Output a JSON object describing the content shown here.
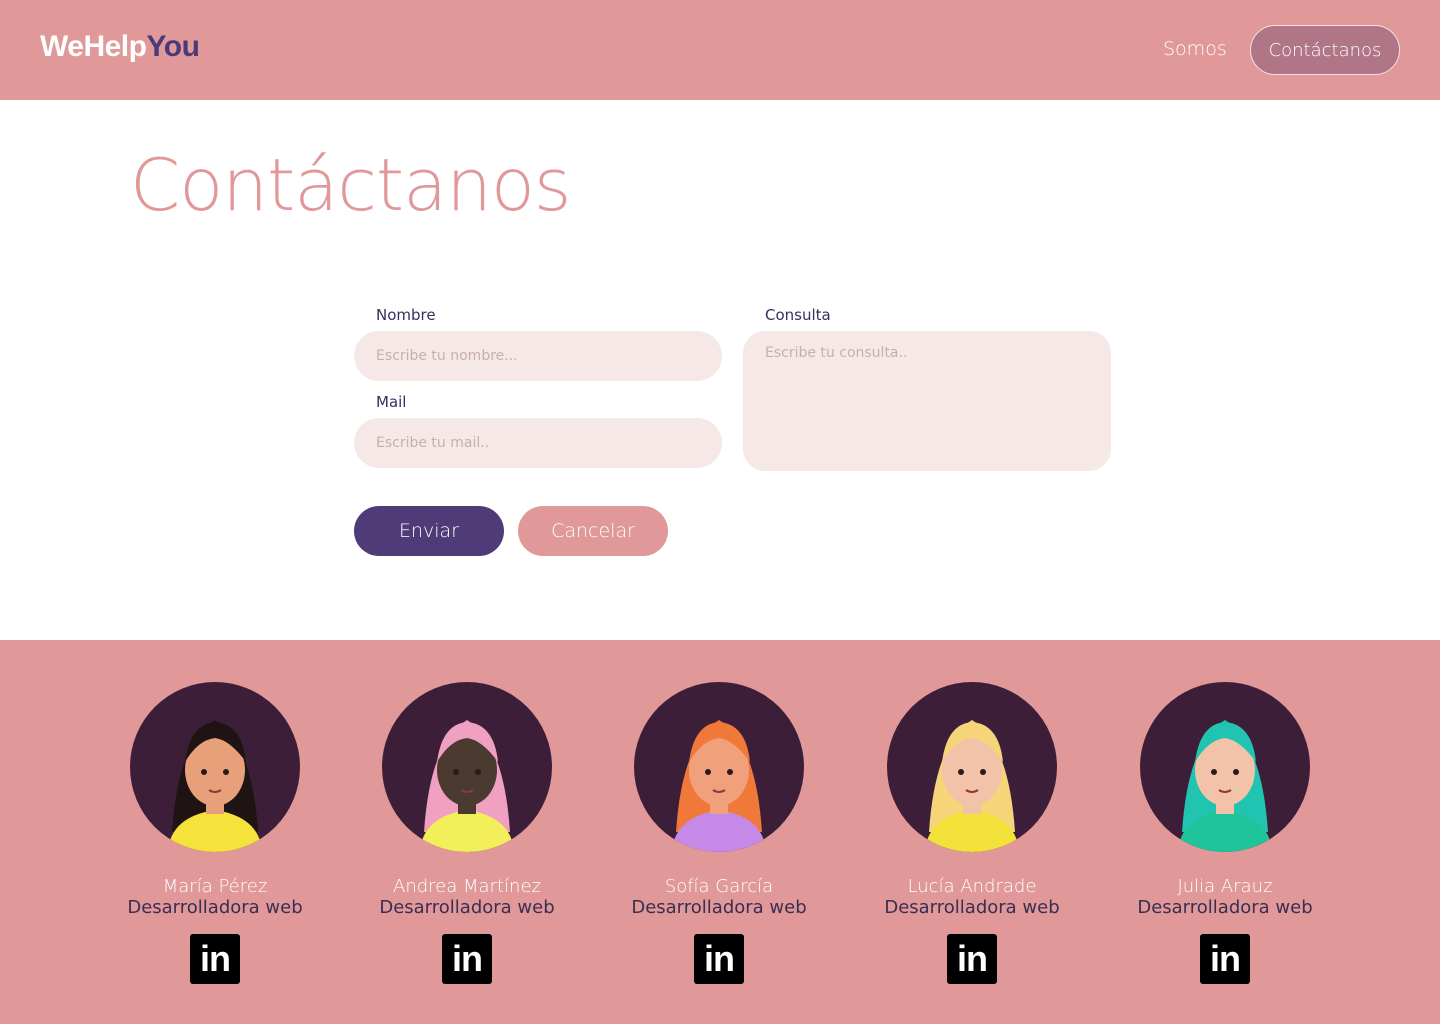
{
  "brand": {
    "part1": "WeHelp",
    "part2": "You"
  },
  "nav": {
    "somos": "Somos",
    "contact": "Contáctanos"
  },
  "page": {
    "title": "Contáctanos"
  },
  "form": {
    "name_label": "Nombre",
    "name_placeholder": "Escribe tu nombre...",
    "mail_label": "Mail",
    "mail_placeholder": "Escribe tu mail..",
    "query_label": "Consulta",
    "query_placeholder": "Escribe tu consulta..",
    "send_label": "Enviar",
    "cancel_label": "Cancelar"
  },
  "team": [
    {
      "name": "María Pérez",
      "role": "Desarrolladora web",
      "linkedin": "in",
      "hair": "#1f1413",
      "skin": "#e8a07a",
      "top": "#f5e23a"
    },
    {
      "name": "Andrea Martínez",
      "role": "Desarrolladora web",
      "linkedin": "in",
      "hair": "#f0a0c0",
      "skin": "#4a3a30",
      "top": "#f3ef5a"
    },
    {
      "name": "Sofía García",
      "role": "Desarrolladora web",
      "linkedin": "in",
      "hair": "#f07838",
      "skin": "#f0a07a",
      "top": "#c58ae8"
    },
    {
      "name": "Lucía Andrade",
      "role": "Desarrolladora web",
      "linkedin": "in",
      "hair": "#f6d47a",
      "skin": "#f2c3a8",
      "top": "#f2e23a"
    },
    {
      "name": "Julia Arauz",
      "role": "Desarrolladora web",
      "linkedin": "in",
      "hair": "#20c4b0",
      "skin": "#f2c3a8",
      "top": "#20c49a"
    }
  ],
  "colors": {
    "header_bg": "#e09898",
    "primary": "#4e3b77",
    "field_bg": "#f7e8e8",
    "avatar_bg": "#3d1e39"
  }
}
